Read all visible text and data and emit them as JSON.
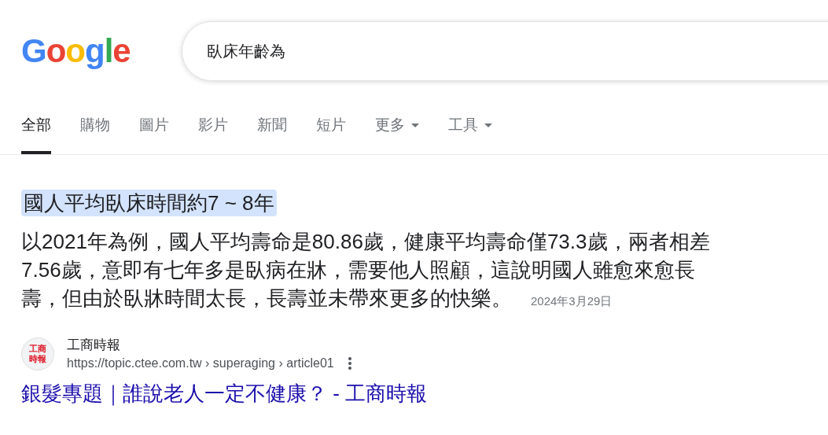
{
  "logo": "Google",
  "search": {
    "value": "臥床年齡為"
  },
  "tabs": [
    {
      "label": "全部",
      "selected": true,
      "dropdown": false
    },
    {
      "label": "購物",
      "selected": false,
      "dropdown": false
    },
    {
      "label": "圖片",
      "selected": false,
      "dropdown": false
    },
    {
      "label": "影片",
      "selected": false,
      "dropdown": false
    },
    {
      "label": "新聞",
      "selected": false,
      "dropdown": false
    },
    {
      "label": "短片",
      "selected": false,
      "dropdown": false
    },
    {
      "label": "更多",
      "selected": false,
      "dropdown": true
    },
    {
      "label": "工具",
      "selected": false,
      "dropdown": true
    }
  ],
  "snippet": {
    "heading": "國人平均臥床時間約7 ~ 8年",
    "text": "以2021年為例，國人平均壽命是80.86歲，健康平均壽命僅73.3歲，兩者相差7.56歲，意即有七年多是臥病在牀，需要他人照顧，這說明國人雖愈來愈長壽，但由於臥牀時間太長，長壽並未帶來更多的快樂。",
    "date": "2024年3月29日"
  },
  "result": {
    "favicon_text": [
      "工商",
      "時報"
    ],
    "site": "工商時報",
    "url": "https://topic.ctee.com.tw › superaging › article01",
    "title": "銀髮專題｜誰說老人一定不健康？ - 工商時報"
  }
}
